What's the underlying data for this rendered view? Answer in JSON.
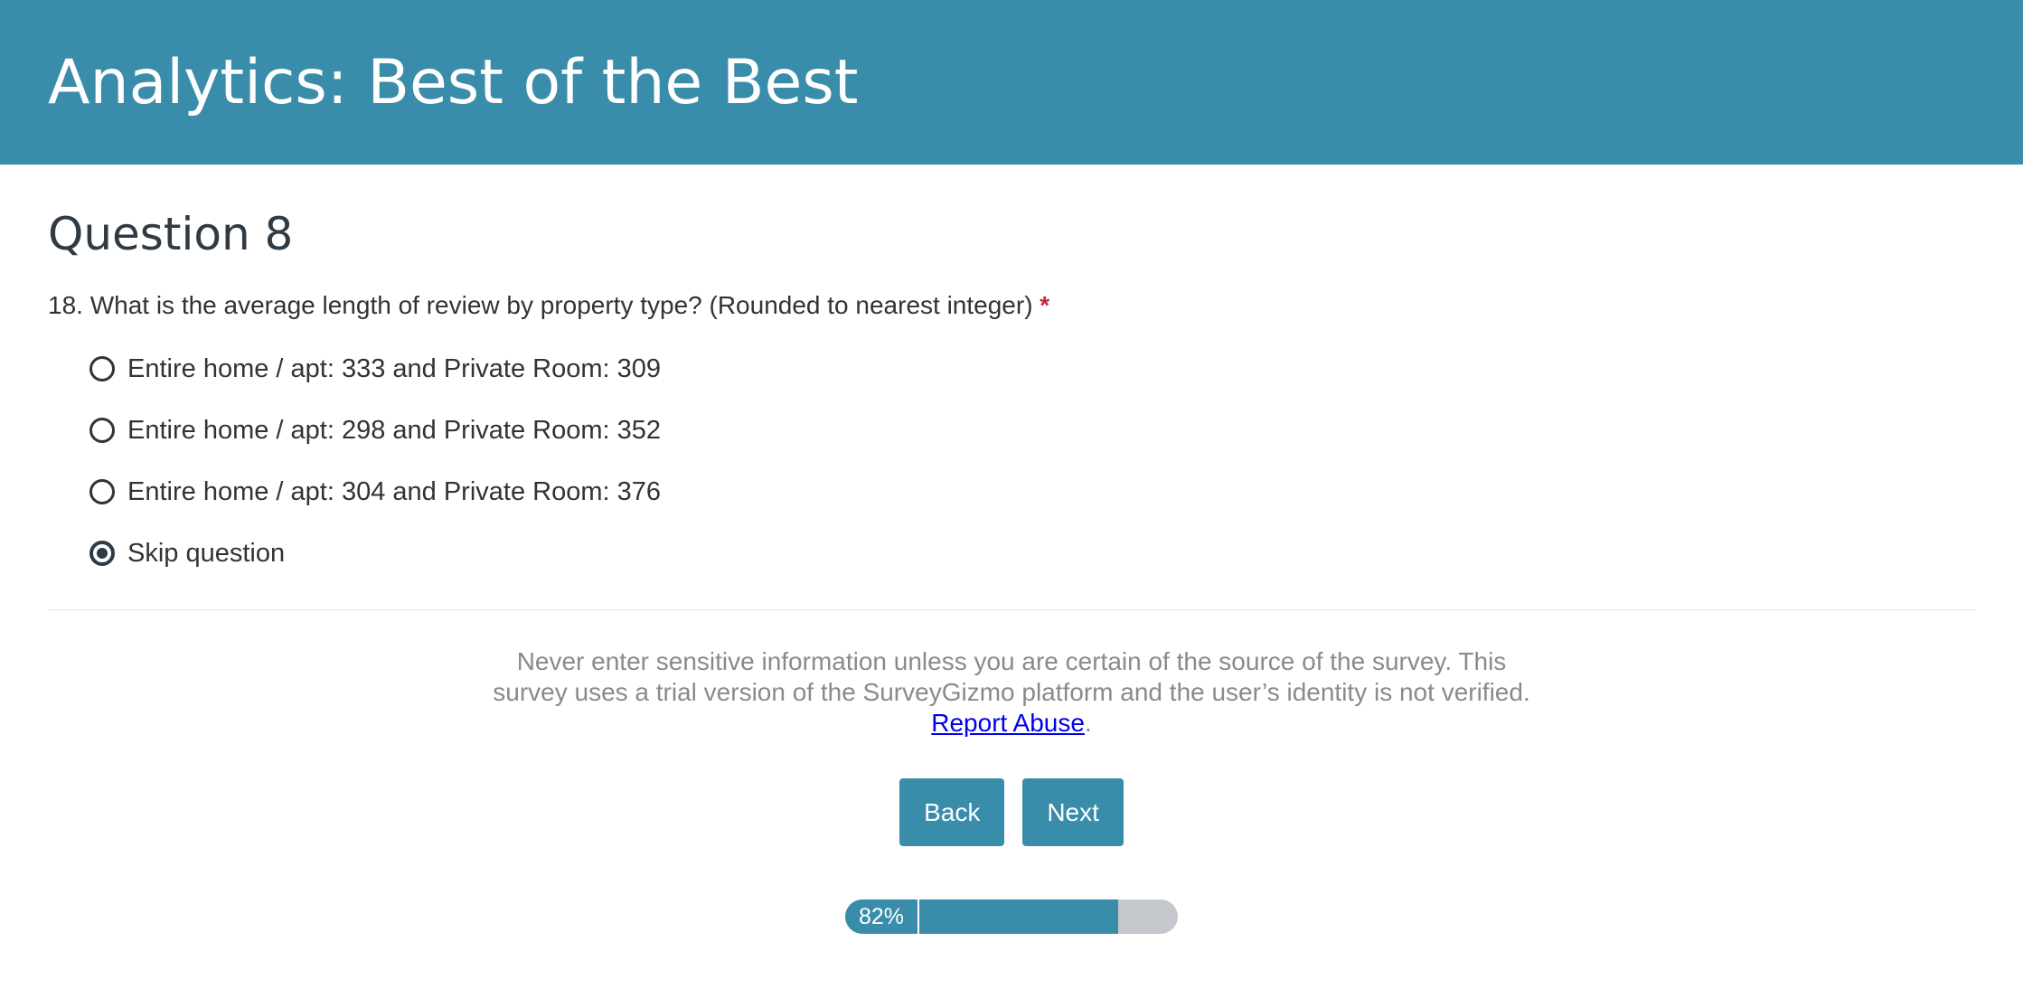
{
  "header": {
    "title": "Analytics: Best of the Best"
  },
  "page": {
    "title": "Question 8"
  },
  "question": {
    "text": "18. What is the average length of review by property type? (Rounded to nearest integer)",
    "required_marker": "*",
    "options": [
      {
        "label": "Entire home / apt: 333 and Private Room: 309",
        "selected": false
      },
      {
        "label": "Entire home / apt: 298 and Private Room: 352",
        "selected": false
      },
      {
        "label": "Entire home / apt: 304 and Private Room: 376",
        "selected": false
      },
      {
        "label": "Skip question",
        "selected": true
      }
    ]
  },
  "disclaimer": {
    "text": "Never enter sensitive information unless you are certain of the source of the survey. This survey uses a trial version of the SurveyGizmo platform and the user’s identity is not verified.",
    "link_label": "Report Abuse",
    "trailing": "."
  },
  "nav": {
    "back_label": "Back",
    "next_label": "Next"
  },
  "progress": {
    "label": "82%",
    "value": 0.82
  },
  "colors": {
    "brand": "#3a8daa",
    "required": "#c0283b",
    "progress_track": "#c5c8cc"
  }
}
